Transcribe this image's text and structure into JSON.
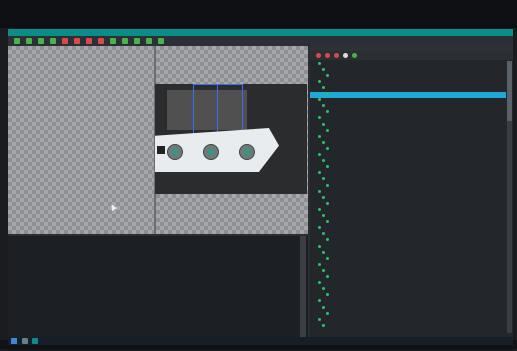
{
  "menubar": {
    "items": [
      "",
      "",
      "",
      ""
    ],
    "window_title": ""
  },
  "toolbar": {
    "buttons": [
      {
        "icon": "tool-icon-1",
        "color": "#4bb34b"
      },
      {
        "icon": "tool-icon-2",
        "color": "#4bb34b"
      },
      {
        "icon": "tool-icon-3",
        "color": "#4bb34b"
      },
      {
        "icon": "tool-icon-4",
        "color": "#4bb34b"
      },
      {
        "icon": "tool-icon-5",
        "color": "#d84a4a"
      },
      {
        "icon": "tool-icon-6",
        "color": "#d84a4a"
      },
      {
        "icon": "tool-icon-7",
        "color": "#d84a4a"
      },
      {
        "icon": "tool-icon-8",
        "color": "#d84a4a"
      },
      {
        "icon": "tool-icon-9",
        "color": "#4bb34b"
      },
      {
        "icon": "tool-icon-10",
        "color": "#4bb34b"
      },
      {
        "icon": "tool-icon-11",
        "color": "#4bb34b"
      },
      {
        "icon": "tool-icon-12",
        "color": "#4bb34b"
      },
      {
        "icon": "tool-icon-13",
        "color": "#4bb34b"
      }
    ]
  },
  "camera": {
    "status": ""
  },
  "log": {
    "lines": [
      "",
      "",
      "",
      "",
      "",
      "",
      "",
      "",
      "",
      "",
      "",
      "",
      "",
      "",
      "",
      "",
      "",
      "",
      "",
      "",
      "",
      "",
      "",
      "",
      "",
      "",
      "",
      "",
      "",
      ""
    ]
  },
  "panel": {
    "title": "",
    "tools": [
      {
        "icon": "record-icon",
        "color": "#d84a4a"
      },
      {
        "icon": "stop-icon",
        "color": "#d84a4a"
      },
      {
        "icon": "pause-icon",
        "color": "#d84a4a"
      },
      {
        "icon": "copy-icon",
        "color": "#dddddd"
      },
      {
        "icon": "add-icon",
        "color": "#4bb34b"
      }
    ],
    "tree": [
      {
        "label": "",
        "tag": "",
        "selected": false
      },
      {
        "label": "",
        "tag": "",
        "selected": false
      },
      {
        "label": "",
        "tag": "",
        "selected": false
      },
      {
        "label": "",
        "tag": "",
        "selected": false
      },
      {
        "label": "",
        "tag": "",
        "selected": false
      },
      {
        "label": "",
        "tag": "",
        "selected": true
      },
      {
        "label": "",
        "tag": "",
        "selected": false
      },
      {
        "label": "",
        "tag": "",
        "selected": false
      },
      {
        "label": "",
        "tag": "",
        "selected": false
      },
      {
        "label": "",
        "tag": "",
        "selected": false
      },
      {
        "label": "",
        "tag": "",
        "selected": false
      },
      {
        "label": "",
        "tag": "",
        "selected": false
      },
      {
        "label": "",
        "tag": "",
        "selected": false
      },
      {
        "label": "",
        "tag": "",
        "selected": false
      },
      {
        "label": "",
        "tag": "",
        "selected": false
      },
      {
        "label": "",
        "tag": "",
        "selected": false
      },
      {
        "label": "",
        "tag": "",
        "selected": false
      },
      {
        "label": "",
        "tag": "",
        "selected": false
      },
      {
        "label": "",
        "tag": "",
        "selected": false
      },
      {
        "label": "",
        "tag": "",
        "selected": false
      },
      {
        "label": "",
        "tag": "",
        "selected": false
      },
      {
        "label": "",
        "tag": "",
        "selected": false
      },
      {
        "label": "",
        "tag": "",
        "selected": false
      },
      {
        "label": "",
        "tag": "",
        "selected": false
      },
      {
        "label": "",
        "tag": "",
        "selected": false
      },
      {
        "label": "",
        "tag": "",
        "selected": false
      },
      {
        "label": "",
        "tag": "",
        "selected": false
      },
      {
        "label": "",
        "tag": "",
        "selected": false
      },
      {
        "label": "",
        "tag": "",
        "selected": false
      },
      {
        "label": "",
        "tag": "",
        "selected": false
      },
      {
        "label": "",
        "tag": "",
        "selected": false
      },
      {
        "label": "",
        "tag": "",
        "selected": false
      },
      {
        "label": "",
        "tag": "",
        "selected": false
      },
      {
        "label": "",
        "tag": "",
        "selected": false
      },
      {
        "label": "",
        "tag": "",
        "selected": false
      },
      {
        "label": "",
        "tag": "",
        "selected": false
      },
      {
        "label": "",
        "tag": "",
        "selected": false
      },
      {
        "label": "",
        "tag": "",
        "selected": false
      },
      {
        "label": "",
        "tag": "",
        "selected": false
      },
      {
        "label": "",
        "tag": "",
        "selected": false
      },
      {
        "label": "",
        "tag": "",
        "selected": false
      },
      {
        "label": "",
        "tag": "",
        "selected": false
      },
      {
        "label": "",
        "tag": "",
        "selected": false
      },
      {
        "label": "",
        "tag": "",
        "selected": false
      }
    ]
  },
  "statusbar": {
    "left": "",
    "right": ""
  },
  "taskbar": {
    "clock": ""
  },
  "colors": {
    "accent": "#0b8c88",
    "selection": "#20a9d6",
    "roi": "#3b6ef0"
  }
}
